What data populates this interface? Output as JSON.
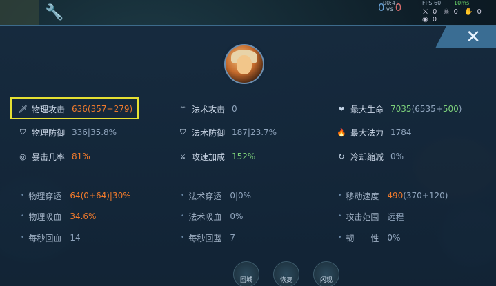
{
  "hud": {
    "score_blue": "0",
    "score_vs": "vs",
    "score_red": "0",
    "clock": "00:41",
    "fps": "FPS 60",
    "ping": "10ms",
    "kills": "0",
    "deaths": "0",
    "assists": "0",
    "gold": "0"
  },
  "panel": {
    "close_label": "✕"
  },
  "primary_stats": [
    {
      "label": "物理攻击",
      "value_main": "636",
      "value_detail": "(357+279)",
      "icon": "sword-icon",
      "color": "orange"
    },
    {
      "label": "法术攻击",
      "value_main": "0",
      "value_detail": "",
      "icon": "wand-icon",
      "color": "default"
    },
    {
      "label": "最大生命",
      "value_main": "7035",
      "value_detail": "(6535+500)",
      "icon": "heart-icon",
      "color": "green"
    },
    {
      "label": "物理防御",
      "value_main": "336|35.8%",
      "value_detail": "",
      "icon": "shield-icon",
      "color": "default"
    },
    {
      "label": "法术防御",
      "value_main": "187|23.7%",
      "value_detail": "",
      "icon": "magic-shield-icon",
      "color": "default"
    },
    {
      "label": "最大法力",
      "value_main": "1784",
      "value_detail": "",
      "icon": "flame-icon",
      "color": "default"
    },
    {
      "label": "暴击几率",
      "value_main": "81%",
      "value_detail": "",
      "icon": "crit-icon",
      "color": "orange"
    },
    {
      "label": "攻速加成",
      "value_main": "152%",
      "value_detail": "",
      "icon": "attack-speed-icon",
      "color": "green"
    },
    {
      "label": "冷却缩减",
      "value_main": "0%",
      "value_detail": "",
      "icon": "cooldown-icon",
      "color": "default"
    }
  ],
  "secondary_stats": [
    {
      "label": "物理穿透",
      "value_main": "64",
      "value_detail": "(0+64)|30%",
      "color": "orange"
    },
    {
      "label": "法术穿透",
      "value_main": "0|0%",
      "value_detail": "",
      "color": "default"
    },
    {
      "label": "移动速度",
      "value_main": "490",
      "value_detail": "(370+120)",
      "color": "default"
    },
    {
      "label": "物理吸血",
      "value_main": "34.6%",
      "value_detail": "",
      "color": "orange"
    },
    {
      "label": "法术吸血",
      "value_main": "0%",
      "value_detail": "",
      "color": "default"
    },
    {
      "label": "攻击范围",
      "value_main": "远程",
      "value_detail": "",
      "color": "default"
    },
    {
      "label": "每秒回血",
      "value_main": "14",
      "value_detail": "",
      "color": "default"
    },
    {
      "label": "每秒回蓝",
      "value_main": "7",
      "value_detail": "",
      "color": "default"
    },
    {
      "label": "韧　　性",
      "value_main": "0%",
      "value_detail": "",
      "color": "default"
    }
  ],
  "skills": [
    {
      "label": "回城"
    },
    {
      "label": "恢复"
    },
    {
      "label": "闪现"
    }
  ]
}
